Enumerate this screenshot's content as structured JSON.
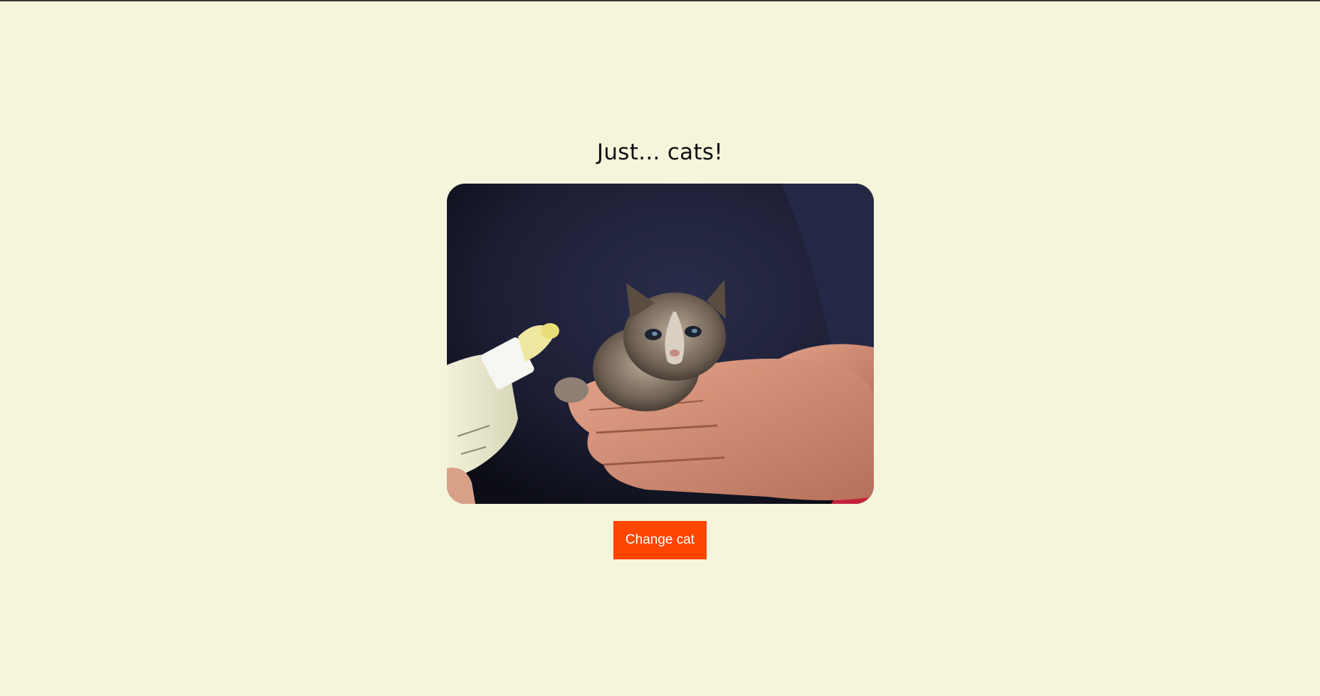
{
  "page": {
    "title": "Just... cats!",
    "background_color": "#f5f5dc"
  },
  "photo": {
    "icon": "kitten-photo-image"
  },
  "actions": {
    "change_label": "Change cat",
    "button_color": "#ff4500"
  }
}
